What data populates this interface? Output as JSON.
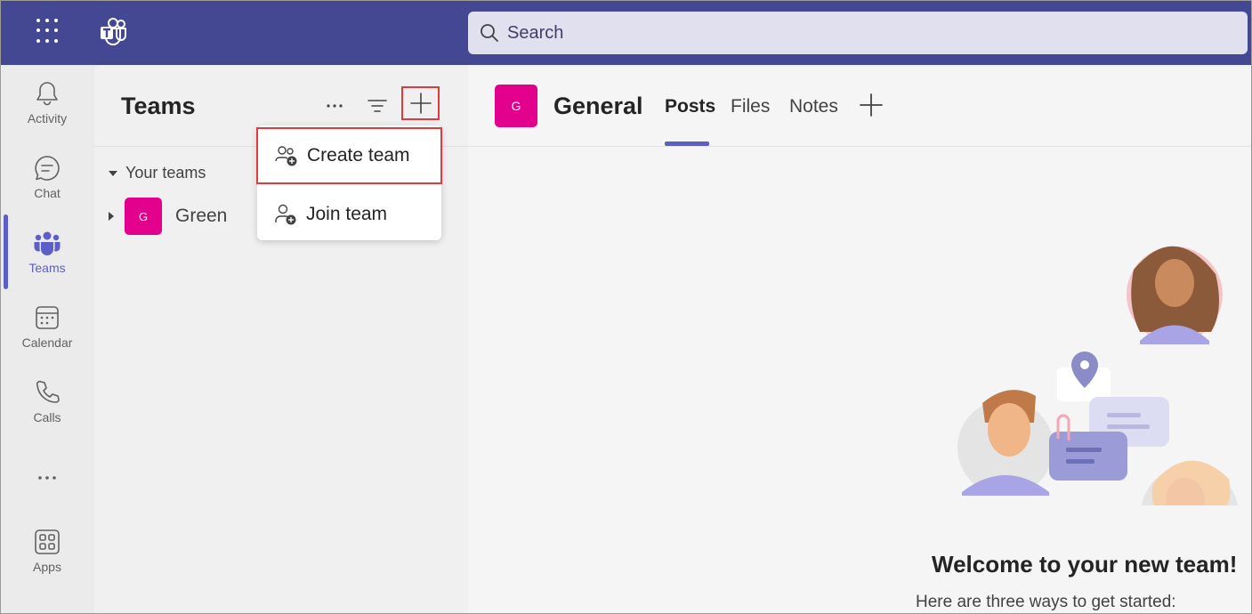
{
  "topbar": {
    "search_placeholder": "Search"
  },
  "rail": {
    "items": [
      {
        "label": "Activity",
        "icon": "bell-icon"
      },
      {
        "label": "Chat",
        "icon": "chat-icon"
      },
      {
        "label": "Teams",
        "icon": "teams-icon",
        "active": true
      },
      {
        "label": "Calendar",
        "icon": "calendar-icon"
      },
      {
        "label": "Calls",
        "icon": "phone-icon"
      },
      {
        "label": "",
        "icon": "more-icon"
      },
      {
        "label": "Apps",
        "icon": "apps-icon"
      }
    ]
  },
  "panel": {
    "title": "Teams",
    "your_teams_label": "Your teams",
    "teams": [
      {
        "initial": "G",
        "name": "Green"
      }
    ]
  },
  "menu": {
    "create_team": "Create team",
    "join_team": "Join team"
  },
  "main": {
    "avatar_initial": "G",
    "channel_name": "General",
    "tabs": [
      "Posts",
      "Files",
      "Notes"
    ],
    "welcome_title": "Welcome to your new team!",
    "welcome_sub": "Here are three ways to get started:"
  },
  "colors": {
    "brand": "#444791",
    "accent": "#5b5fc7",
    "team_avatar": "#e3008c",
    "highlight_box": "#e0393e"
  }
}
